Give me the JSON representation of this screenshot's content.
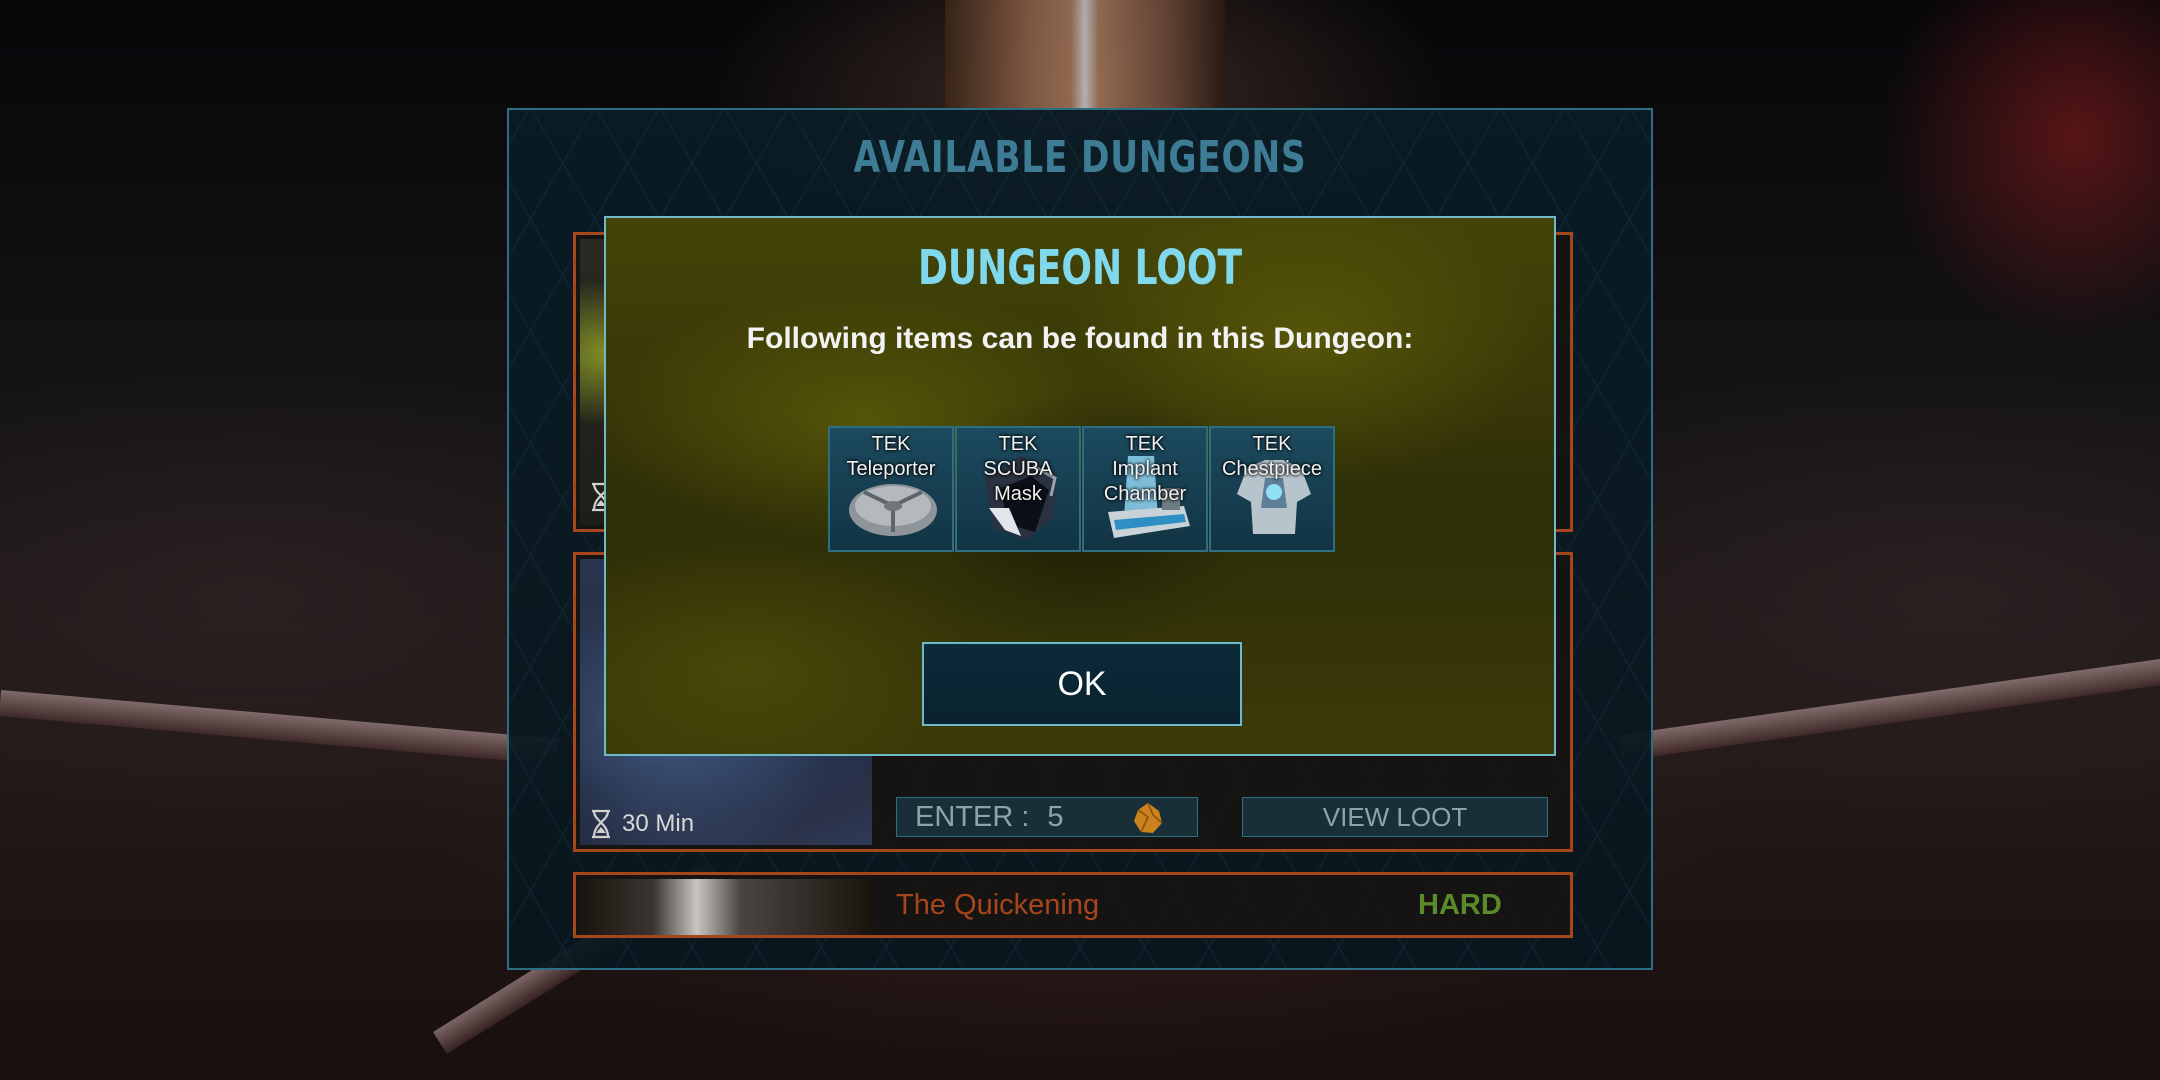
{
  "background": {
    "colors": {
      "accent": "#6fb9cc",
      "card_border": "#a8461b",
      "hard": "#5a8a2a"
    }
  },
  "main_panel": {
    "title": "AVAILABLE DUNGEONS",
    "cards": [
      {
        "timer": "",
        "timer_icon": "hourglass-icon"
      },
      {
        "timer": "30 Min",
        "timer_icon": "hourglass-icon",
        "enter_label": "ENTER :",
        "enter_cost": "5",
        "cost_icon": "element-shard-icon",
        "view_loot_label": "VIEW LOOT"
      },
      {
        "name": "The Quickening",
        "difficulty": "HARD"
      }
    ]
  },
  "dialog": {
    "title": "DUNGEON LOOT",
    "subtitle": "Following items can be found in this Dungeon:",
    "items": [
      {
        "label_lines": [
          "TEK",
          "Teleporter"
        ],
        "icon": "tek-teleporter-icon"
      },
      {
        "label_lines": [
          "TEK",
          "SCUBA",
          "Mask"
        ],
        "icon": "tek-scuba-mask-icon"
      },
      {
        "label_lines": [
          "TEK",
          "Implant",
          "Chamber"
        ],
        "icon": "tek-implant-chamber-icon"
      },
      {
        "label_lines": [
          "TEK",
          "Chestpiece"
        ],
        "icon": "tek-chestpiece-icon"
      }
    ],
    "ok_label": "OK"
  }
}
